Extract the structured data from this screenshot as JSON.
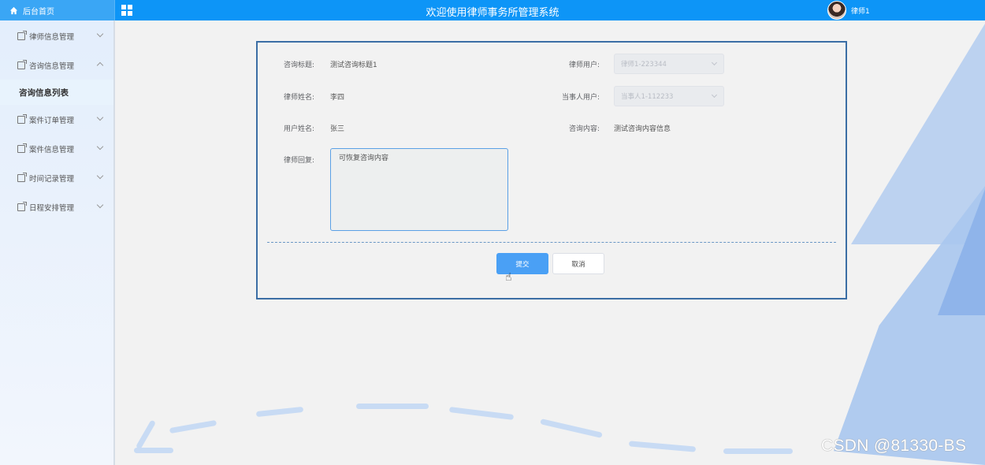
{
  "topbar": {
    "home_label": "后台首页",
    "title": "欢迎使用律师事务所管理系统",
    "username": "律师1",
    "accent_color": "#0d95f7"
  },
  "sidebar": {
    "items": [
      {
        "label": "律师信息管理",
        "expanded": false
      },
      {
        "label": "咨询信息管理",
        "expanded": true
      },
      {
        "label": "案件订单管理",
        "expanded": false
      },
      {
        "label": "案件信息管理",
        "expanded": false
      },
      {
        "label": "时间记录管理",
        "expanded": false
      },
      {
        "label": "日程安排管理",
        "expanded": false
      }
    ],
    "active_submenu": "咨询信息列表"
  },
  "form": {
    "consult_title_label": "咨询标题:",
    "consult_title_value": "测试咨询标题1",
    "lawyer_user_label": "律师用户:",
    "lawyer_user_value": "律师1-223344",
    "lawyer_name_label": "律师姓名:",
    "lawyer_name_value": "李四",
    "client_user_label": "当事人用户:",
    "client_user_value": "当事人1-112233",
    "user_name_label": "用户姓名:",
    "user_name_value": "张三",
    "consult_content_label": "咨询内容:",
    "consult_content_value": "测试咨询内容信息",
    "reply_label": "律师回复:",
    "reply_value": "可恢复咨询内容",
    "submit_label": "提交",
    "cancel_label": "取消"
  },
  "watermark": "CSDN @81330-BS"
}
